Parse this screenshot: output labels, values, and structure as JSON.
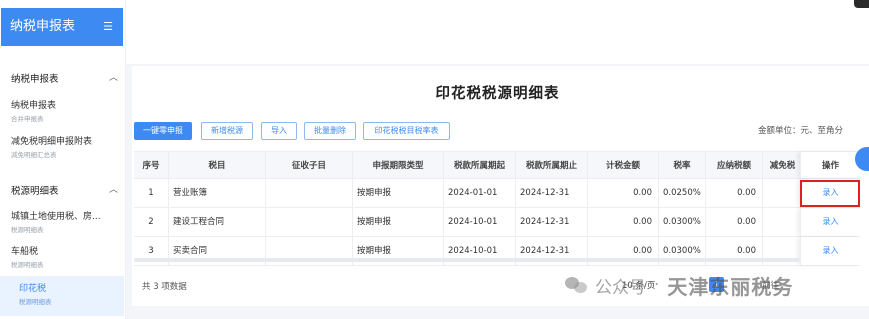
{
  "app": {
    "title": "纳税申报表",
    "menu_icon": "menu-icon"
  },
  "sidebar": {
    "groups": [
      {
        "title": "纳税申报表",
        "items": [
          {
            "label": "纳税申报表",
            "sub": "合并申报表"
          },
          {
            "label": "减免税明细申报附表",
            "sub": "减免明细汇总表"
          }
        ]
      },
      {
        "title": "税源明细表",
        "items": [
          {
            "label": "城镇土地使用税、房...",
            "sub": "税源明细表"
          },
          {
            "label": "车船税",
            "sub": "税源明细表"
          },
          {
            "label": "印花税",
            "sub": "税源明细表"
          }
        ]
      }
    ],
    "chevron": "︿"
  },
  "page": {
    "title": "印花税税源明细表",
    "unit_label": "金额单位：",
    "unit_value": "元、至角分"
  },
  "toolbar": {
    "buttons": [
      "一键零申报",
      "新增税源",
      "导入",
      "批量删除",
      "印花税税目税率表"
    ]
  },
  "table": {
    "columns": [
      "序号",
      "税目",
      "征收子目",
      "申报期限类型",
      "税款所属期起",
      "税款所属期止",
      "计税金额",
      "税率",
      "应纳税额",
      "减免税",
      "操作"
    ],
    "rows": [
      {
        "no": "1",
        "item": "营业账簿",
        "sub_item": "",
        "period_type": "按期申报",
        "start": "2024-01-01",
        "end": "2024-12-31",
        "taxable": "0.00",
        "rate": "0.0250%",
        "payable": "0.00",
        "action": "录入"
      },
      {
        "no": "2",
        "item": "建设工程合同",
        "sub_item": "",
        "period_type": "按期申报",
        "start": "2024-10-01",
        "end": "2024-12-31",
        "taxable": "0.00",
        "rate": "0.0300%",
        "payable": "0.00",
        "action": "录入"
      },
      {
        "no": "3",
        "item": "买卖合同",
        "sub_item": "",
        "period_type": "按期申报",
        "start": "2024-10-01",
        "end": "2024-12-31",
        "taxable": "0.00",
        "rate": "0.0300%",
        "payable": "0.00",
        "action": "录入"
      }
    ]
  },
  "pagination": {
    "total": "共 3 项数据",
    "page_size": "10 条/页",
    "current_page": "1",
    "jump_label": "前往"
  },
  "watermark": {
    "prefix": "公众号",
    "dot": "·",
    "account": "天津东丽税务"
  },
  "colors": {
    "accent": "#3d8bf2",
    "highlight": "#e02020"
  }
}
